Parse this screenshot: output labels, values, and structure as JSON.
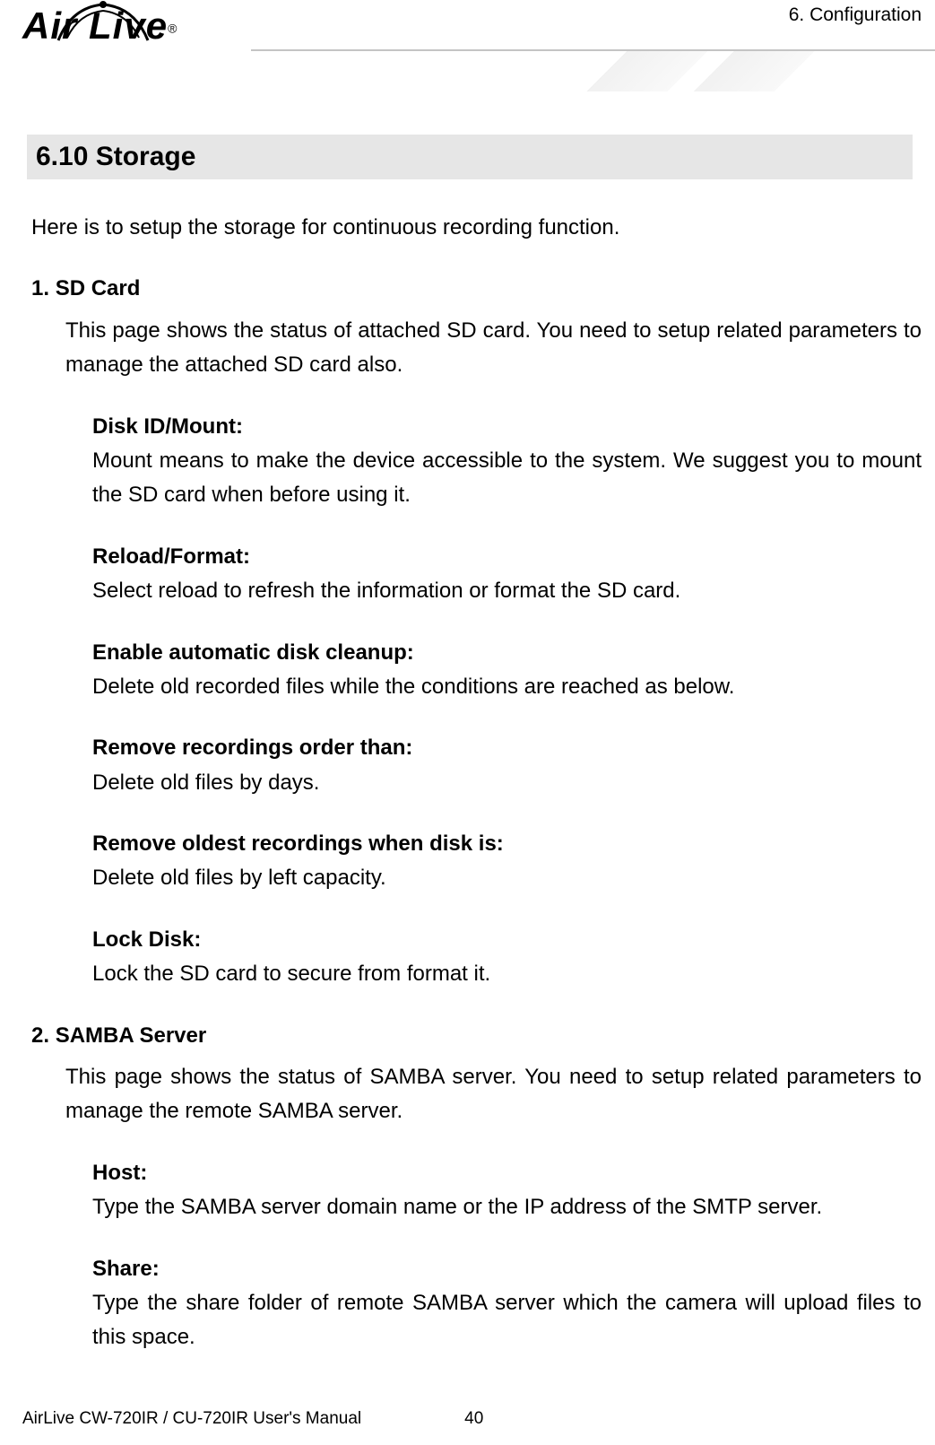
{
  "header": {
    "logo_text": "Air Live",
    "chapter_label": "6. Configuration"
  },
  "section": {
    "heading": "6.10  Storage",
    "intro": "Here is to setup the storage for continuous recording function."
  },
  "items": [
    {
      "number": "1.",
      "title": "SD Card",
      "desc": "This page shows the status of attached SD card. You need to setup related parameters to manage the attached SD card also.",
      "subs": [
        {
          "title": "Disk ID/Mount:",
          "desc": "Mount means to make the device accessible to the system. We suggest you to mount the SD card when before using it."
        },
        {
          "title": "Reload/Format:",
          "desc": "Select reload to refresh the information or format the SD card."
        },
        {
          "title": "Enable automatic disk cleanup:",
          "desc": "Delete old recorded files while the conditions are reached as below."
        },
        {
          "title": "Remove recordings order than:",
          "desc": "Delete old files by days."
        },
        {
          "title": "Remove oldest recordings when disk is:",
          "desc": "Delete old files by left capacity."
        },
        {
          "title": "Lock Disk:",
          "desc": "Lock the SD card to secure from format it."
        }
      ]
    },
    {
      "number": "2.",
      "title": "SAMBA Server",
      "desc": "This page shows the status of SAMBA server. You need to setup related parameters to manage the remote SAMBA server.",
      "subs": [
        {
          "title": "Host:",
          "desc": "Type the SAMBA server domain name or the IP address of the SMTP server."
        },
        {
          "title": "Share:",
          "desc": "Type the share folder of remote SAMBA server which the camera will upload files to this space."
        }
      ]
    }
  ],
  "footer": {
    "manual_title": "AirLive CW-720IR / CU-720IR User's Manual",
    "page_number": "40"
  }
}
